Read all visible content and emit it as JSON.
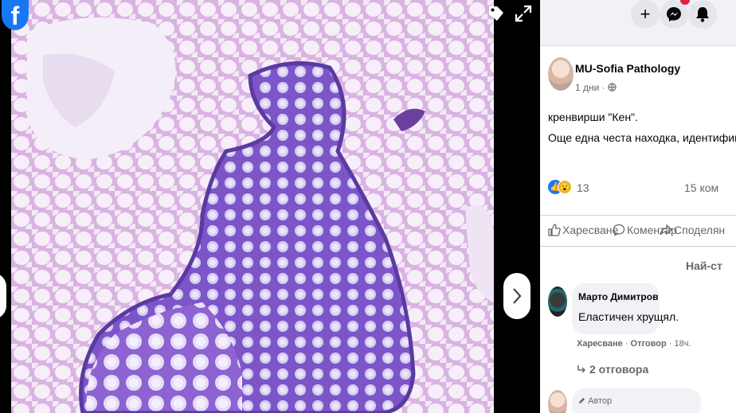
{
  "viewer": {
    "logo_letter": "f",
    "icons": {
      "logo": "facebook-logo",
      "tag": "tag-icon",
      "expand": "expand-icon",
      "next": "chevron-right-icon"
    }
  },
  "topbar": {
    "create_label": "+",
    "icons": [
      "plus-icon",
      "messenger-icon",
      "bell-icon"
    ]
  },
  "post": {
    "author": "MU-Sofia Pathology",
    "time": "1 дни",
    "audience_icon": "globe-icon",
    "text_line1": "кренвирши \"Кен\".",
    "text_line2": "Още една честа находка, идентифицирай"
  },
  "reactions": {
    "count": "13",
    "comments": "15 ком",
    "types": [
      "like",
      "wow"
    ]
  },
  "actions": {
    "like": "Харесване",
    "comment": "Коментар",
    "share": "Споделян"
  },
  "comments_sort": "Най-ст",
  "comments": [
    {
      "name": "Марто Димитров",
      "text": "Еластичен хрущял.",
      "like_label": "Харесване",
      "reply_label": "Отговор",
      "time": "18ч.",
      "replies_label": "2 отговора"
    }
  ],
  "reply_preview": {
    "author_tag": "Автор"
  },
  "colors": {
    "brand": "#1877f2",
    "stain_purple": "#7a52c4",
    "stain_pink": "#e6cdeb"
  }
}
